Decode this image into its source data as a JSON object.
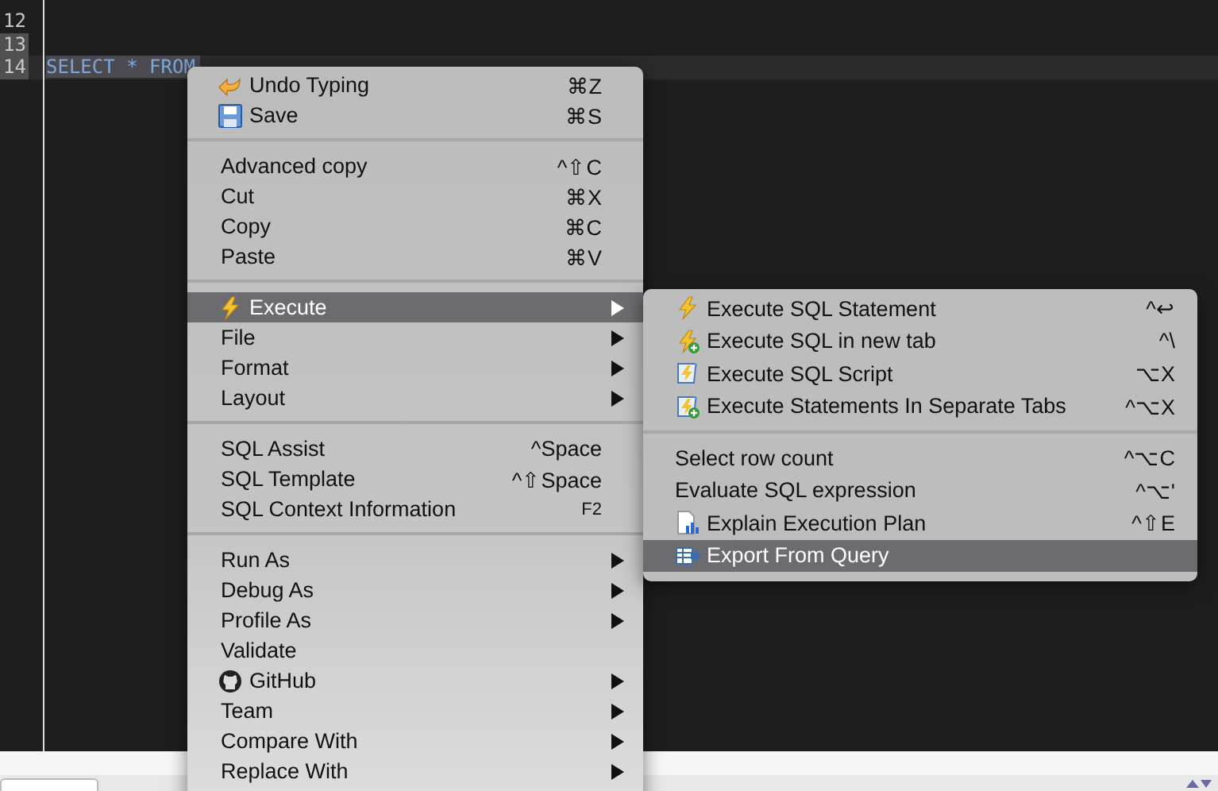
{
  "editor": {
    "lines": [
      {
        "number": "12",
        "current": false,
        "marked": false
      },
      {
        "number": "13",
        "current": false,
        "marked": true
      },
      {
        "number": "14",
        "code": "SELECT * FROM",
        "current": true,
        "marked": true
      }
    ]
  },
  "context_menu": {
    "sections": [
      {
        "items": [
          {
            "label": "Undo Typing",
            "kind": "undo",
            "shortcut": "⌘Z",
            "submenu": false,
            "selected": false
          },
          {
            "label": "Save",
            "kind": "save",
            "shortcut": "⌘S",
            "submenu": false,
            "selected": false
          }
        ]
      },
      {
        "items": [
          {
            "label": "Advanced copy",
            "kind": "plain",
            "shortcut": "^⇧C",
            "submenu": false,
            "selected": false
          },
          {
            "label": "Cut",
            "kind": "plain",
            "shortcut": "⌘X",
            "submenu": false,
            "selected": false
          },
          {
            "label": "Copy",
            "kind": "plain",
            "shortcut": "⌘C",
            "submenu": false,
            "selected": false
          },
          {
            "label": "Paste",
            "kind": "plain",
            "shortcut": "⌘V",
            "submenu": false,
            "selected": false
          }
        ]
      },
      {
        "items": [
          {
            "label": "Execute",
            "kind": "bolt",
            "submenu": true,
            "selected": true
          },
          {
            "label": "File",
            "kind": "plain",
            "submenu": true,
            "selected": false
          },
          {
            "label": "Format",
            "kind": "plain",
            "submenu": true,
            "selected": false
          },
          {
            "label": "Layout",
            "kind": "plain",
            "submenu": true,
            "selected": false
          }
        ]
      },
      {
        "items": [
          {
            "label": "SQL Assist",
            "kind": "plain",
            "shortcut": "^Space",
            "submenu": false,
            "selected": false
          },
          {
            "label": "SQL Template",
            "kind": "plain",
            "shortcut": "^⇧Space",
            "submenu": false,
            "selected": false
          },
          {
            "label": "SQL Context Information",
            "kind": "plain",
            "shortcut": "F2",
            "submenu": false,
            "selected": false
          }
        ]
      },
      {
        "items": [
          {
            "label": "Run As",
            "kind": "plain",
            "submenu": true,
            "selected": false
          },
          {
            "label": "Debug As",
            "kind": "plain",
            "submenu": true,
            "selected": false
          },
          {
            "label": "Profile As",
            "kind": "plain",
            "submenu": true,
            "selected": false
          },
          {
            "label": "Validate",
            "kind": "plain",
            "submenu": false,
            "selected": false
          },
          {
            "label": "GitHub",
            "kind": "github",
            "submenu": true,
            "selected": false
          },
          {
            "label": "Team",
            "kind": "plain",
            "submenu": true,
            "selected": false
          },
          {
            "label": "Compare With",
            "kind": "plain",
            "submenu": true,
            "selected": false
          },
          {
            "label": "Replace With",
            "kind": "plain",
            "submenu": true,
            "selected": false
          }
        ]
      }
    ]
  },
  "execute_submenu": {
    "sections": [
      {
        "items": [
          {
            "label": "Execute SQL Statement",
            "kind": "bolt",
            "shortcut": "^↩",
            "selected": false
          },
          {
            "label": "Execute SQL in new tab",
            "kind": "bolt-plus",
            "shortcut": "^\\",
            "selected": false
          },
          {
            "label": "Execute SQL Script",
            "kind": "script",
            "shortcut": "⌥X",
            "selected": false
          },
          {
            "label": "Execute Statements In Separate Tabs",
            "kind": "script-plus",
            "shortcut": "^⌥X",
            "selected": false
          }
        ]
      },
      {
        "items": [
          {
            "label": "Select row count",
            "kind": "plain",
            "shortcut": "^⌥C",
            "selected": false
          },
          {
            "label": "Evaluate SQL expression",
            "kind": "plain",
            "shortcut": "^⌥'",
            "selected": false
          },
          {
            "label": "Explain Execution Plan",
            "kind": "plan",
            "shortcut": "^⇧E",
            "selected": false
          },
          {
            "label": "Export From Query",
            "kind": "export",
            "selected": true
          }
        ]
      }
    ]
  }
}
